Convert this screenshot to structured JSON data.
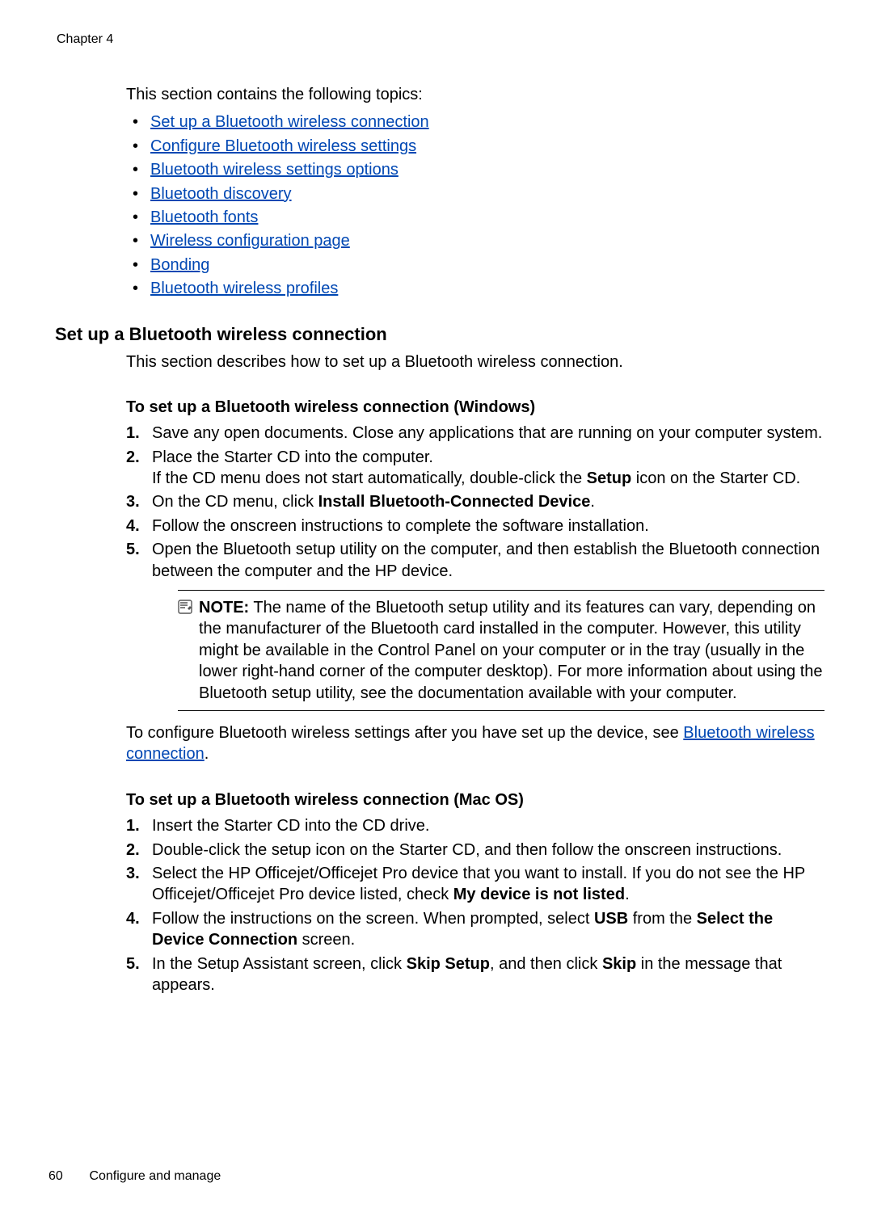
{
  "chapter": "Chapter 4",
  "intro": "This section contains the following topics:",
  "toc": [
    "Set up a Bluetooth wireless connection",
    "Configure Bluetooth wireless settings",
    "Bluetooth wireless settings options",
    "Bluetooth discovery",
    "Bluetooth fonts",
    "Wireless configuration page",
    "Bonding",
    "Bluetooth wireless profiles"
  ],
  "heading": "Set up a Bluetooth wireless connection",
  "heading_desc": "This section describes how to set up a Bluetooth wireless connection.",
  "win": {
    "title": "To set up a Bluetooth wireless connection (Windows)",
    "steps": {
      "s1": "Save any open documents. Close any applications that are running on your computer system.",
      "s2a": "Place the Starter CD into the computer.",
      "s2b_pre": "If the CD menu does not start automatically, double-click the ",
      "s2b_bold": "Setup",
      "s2b_post": " icon on the Starter CD.",
      "s3_pre": "On the CD menu, click ",
      "s3_bold": "Install Bluetooth-Connected Device",
      "s3_post": ".",
      "s4": "Follow the onscreen instructions to complete the software installation.",
      "s5": "Open the Bluetooth setup utility on the computer, and then establish the Bluetooth connection between the computer and the HP device."
    },
    "note_label": "NOTE:",
    "note_text": "  The name of the Bluetooth setup utility and its features can vary, depending on the manufacturer of the Bluetooth card installed in the computer. However, this utility might be available in the Control Panel on your computer or in the tray (usually in the lower right-hand corner of the computer desktop). For more information about using the Bluetooth setup utility, see the documentation available with your computer.",
    "after_note_pre": "To configure Bluetooth wireless settings after you have set up the device, see ",
    "after_note_link": "Bluetooth wireless connection",
    "after_note_post": "."
  },
  "mac": {
    "title": "To set up a Bluetooth wireless connection (Mac OS)",
    "steps": {
      "s1": "Insert the Starter CD into the CD drive.",
      "s2": "Double-click the setup icon on the Starter CD, and then follow the onscreen instructions.",
      "s3_pre": "Select the HP Officejet/Officejet Pro device that you want to install. If you do not see the HP Officejet/Officejet Pro device listed, check ",
      "s3_bold": "My device is not listed",
      "s3_post": ".",
      "s4_pre": "Follow the instructions on the screen. When prompted, select ",
      "s4_b1": "USB",
      "s4_mid": " from the ",
      "s4_b2": "Select the Device Connection",
      "s4_post": " screen.",
      "s5_pre": "In the Setup Assistant screen, click ",
      "s5_b1": "Skip Setup",
      "s5_mid": ", and then click ",
      "s5_b2": "Skip",
      "s5_post": " in the message that appears."
    }
  },
  "footer": {
    "page": "60",
    "title": "Configure and manage"
  }
}
